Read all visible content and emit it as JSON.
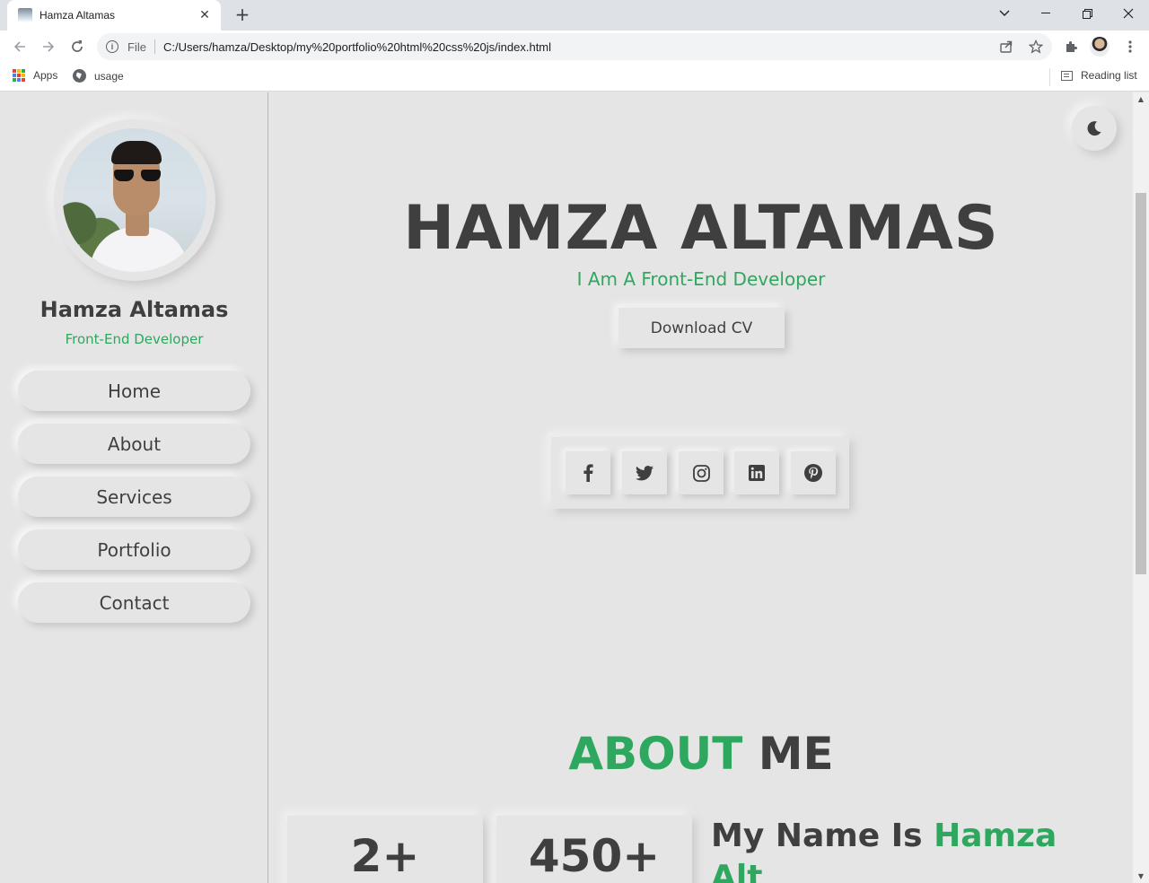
{
  "browser": {
    "tab_title": "Hamza Altamas",
    "tab_close": "✕",
    "new_tab": "+",
    "scheme": "File",
    "url": "C:/Users/hamza/Desktop/my%20portfolio%20html%20css%20js/index.html",
    "bookmarks": [
      {
        "label": "Apps",
        "icon": "apps-icon"
      },
      {
        "label": "usage",
        "icon": "globe-icon"
      }
    ],
    "reading_list": "Reading list"
  },
  "sidebar": {
    "name": "Hamza Altamas",
    "role": "Front-End Developer",
    "nav": [
      "Home",
      "About",
      "Services",
      "Portfolio",
      "Contact"
    ]
  },
  "hero": {
    "title": "HAMZA ALTAMAS",
    "subtitle": "I Am A Front-End Developer",
    "cv_button": "Download CV",
    "socials": [
      "facebook-icon",
      "twitter-icon",
      "instagram-icon",
      "linkedin-icon",
      "pinterest-icon"
    ]
  },
  "about": {
    "title_accent": "ABOUT",
    "title_rest": "ME",
    "stats": [
      "2+",
      "450+"
    ],
    "name_prefix": "My Name Is",
    "name_accent": "Hamza",
    "name_cut": "Alt"
  },
  "colors": {
    "accent": "#2ea85f",
    "background": "#e5e5e5",
    "text": "#3f3f3f"
  }
}
